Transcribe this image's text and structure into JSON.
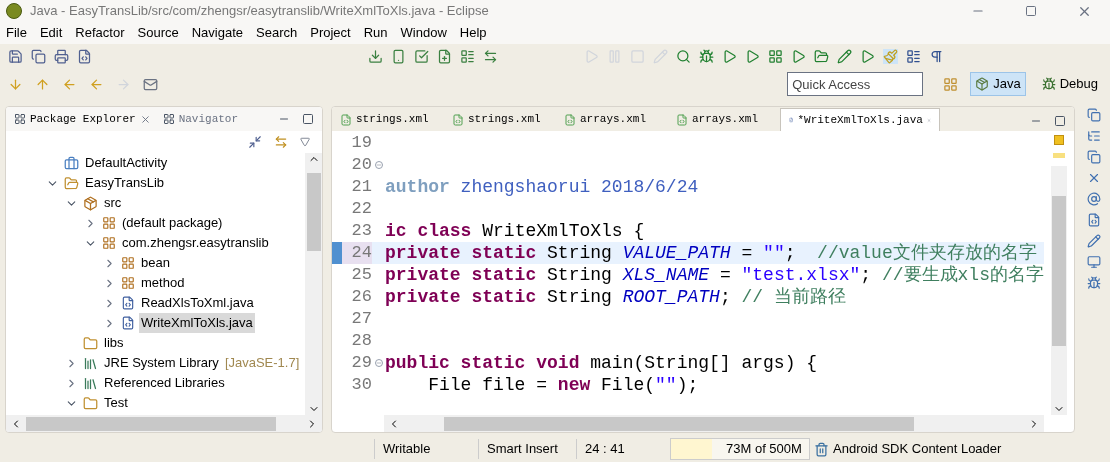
{
  "window": {
    "title": "Java - EasyTransLib/src/com/zhengsr/easytranslib/WriteXmlToXls.java - Eclipse"
  },
  "menu": [
    "File",
    "Edit",
    "Refactor",
    "Source",
    "Navigate",
    "Search",
    "Project",
    "Run",
    "Window",
    "Help"
  ],
  "quick_access": {
    "placeholder": "Quick Access"
  },
  "perspectives": [
    {
      "label": "Java",
      "selected": true
    },
    {
      "label": "Debug",
      "selected": false
    }
  ],
  "explorer": {
    "tabs": [
      {
        "label": "Package Explorer",
        "selected": true
      },
      {
        "label": "Navigator",
        "selected": false
      }
    ],
    "tree": [
      {
        "label": "DefaultActivity",
        "kind": "project"
      },
      {
        "label": "EasyTransLib",
        "kind": "project-open",
        "expanded": true,
        "children": [
          {
            "label": "src",
            "kind": "source",
            "expanded": true,
            "children": [
              {
                "label": "(default package)",
                "kind": "package",
                "expanded": false
              },
              {
                "label": "com.zhengsr.easytranslib",
                "kind": "package",
                "expanded": true,
                "children": [
                  {
                    "label": "bean",
                    "kind": "package",
                    "expanded": false
                  },
                  {
                    "label": "method",
                    "kind": "package",
                    "expanded": false
                  },
                  {
                    "label": "ReadXlsToXml.java",
                    "kind": "java",
                    "expanded": false,
                    "selected": false
                  },
                  {
                    "label": "WriteXmlToXls.java",
                    "kind": "java",
                    "expanded": false,
                    "selected": true
                  }
                ]
              }
            ]
          },
          {
            "label": "libs",
            "kind": "folder"
          },
          {
            "label": "JRE System Library",
            "note": "[JavaSE-1.7]",
            "kind": "library",
            "expanded": false
          },
          {
            "label": "Referenced Libraries",
            "kind": "library",
            "expanded": false
          },
          {
            "label": "Test",
            "kind": "folder",
            "expanded": true
          }
        ]
      }
    ]
  },
  "editor": {
    "tabs": [
      {
        "label": "strings.xml",
        "kind": "xml",
        "selected": false
      },
      {
        "label": "strings.xml",
        "kind": "xml",
        "selected": false
      },
      {
        "label": "arrays.xml",
        "kind": "xml",
        "selected": false
      },
      {
        "label": "arrays.xml",
        "kind": "xml",
        "selected": false
      },
      {
        "label": "*WriteXmlToXls.java",
        "kind": "java",
        "selected": true
      }
    ],
    "lines": [
      {
        "number": "19"
      },
      {
        "number": "20",
        "fold": true
      },
      {
        "number": "21",
        "tokens": [
          {
            "kind": "doctag",
            "text": "author"
          },
          {
            "kind": "doc",
            "text": " zhengshaorui 2018/6/24"
          }
        ]
      },
      {
        "number": "22"
      },
      {
        "number": "23",
        "tokens": [
          {
            "kind": "keyword",
            "text": "ic class"
          },
          {
            "kind": "plain",
            "text": " WriteXmlToXls {"
          }
        ]
      },
      {
        "number": "24",
        "current": true,
        "tokens": [
          {
            "kind": "keyword",
            "text": "private static"
          },
          {
            "kind": "plain",
            "text": " String "
          },
          {
            "kind": "field",
            "text": "VALUE_PATH"
          },
          {
            "kind": "plain",
            "text": " = "
          },
          {
            "kind": "string",
            "text": "\"\""
          },
          {
            "kind": "plain",
            "text": ";  "
          },
          {
            "kind": "comment",
            "text": "//value文件夹存放的名字"
          }
        ]
      },
      {
        "number": "25",
        "tokens": [
          {
            "kind": "keyword",
            "text": "private static"
          },
          {
            "kind": "plain",
            "text": " String "
          },
          {
            "kind": "field",
            "text": "XLS_NAME"
          },
          {
            "kind": "plain",
            "text": " = "
          },
          {
            "kind": "string",
            "text": "\"test.xlsx\""
          },
          {
            "kind": "plain",
            "text": "; "
          },
          {
            "kind": "comment",
            "text": "//要生成xls的名字"
          }
        ]
      },
      {
        "number": "26",
        "tokens": [
          {
            "kind": "keyword",
            "text": "private static"
          },
          {
            "kind": "plain",
            "text": " String "
          },
          {
            "kind": "field",
            "text": "ROOT_PATH"
          },
          {
            "kind": "plain",
            "text": "; "
          },
          {
            "kind": "comment",
            "text": "// 当前路径"
          }
        ]
      },
      {
        "number": "27"
      },
      {
        "number": "28"
      },
      {
        "number": "29",
        "fold": true,
        "tokens": [
          {
            "kind": "keyword",
            "text": "public static void"
          },
          {
            "kind": "plain",
            "text": " main(String[] args) {"
          }
        ]
      },
      {
        "number": "30",
        "tokens": [
          {
            "kind": "plain",
            "text": "    File file = "
          },
          {
            "kind": "keyword",
            "text": "new"
          },
          {
            "kind": "plain",
            "text": " File("
          },
          {
            "kind": "string",
            "text": "\"\""
          },
          {
            "kind": "plain",
            "text": ");"
          }
        ]
      }
    ]
  },
  "status_bar": {
    "write_mode": "Writable",
    "insert_mode": "Smart Insert",
    "position": "24 : 41",
    "heap": {
      "reading": "73M of 500M",
      "level": 0.3
    },
    "task": "Android SDK Content Loader"
  }
}
